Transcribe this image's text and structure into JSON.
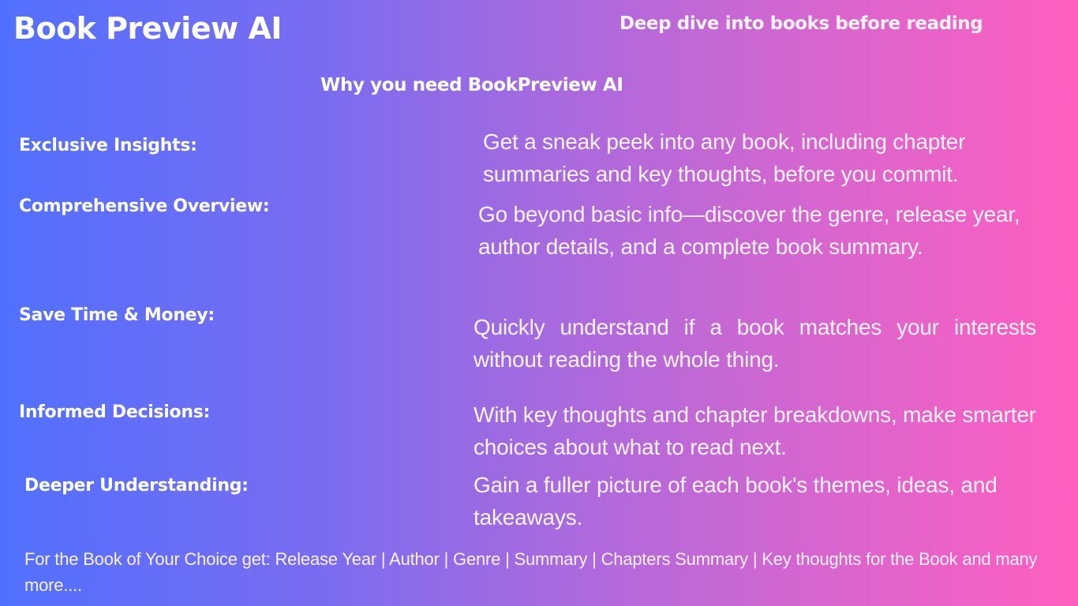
{
  "header": {
    "brand": "Book Preview AI",
    "tagline": "Deep dive into books before reading"
  },
  "section": {
    "heading": "Why you need BookPreview AI"
  },
  "features": [
    {
      "label": "Exclusive Insights:",
      "description": "Get a sneak peek into any book, including chapter summaries and key thoughts, before you commit."
    },
    {
      "label": "Comprehensive Overview:",
      "description": "Go beyond basic info—discover the genre, release year, author details, and a complete book summary."
    },
    {
      "label": "Save Time & Money:",
      "description": "Quickly understand if a book matches your interests without reading the whole thing."
    },
    {
      "label": "Informed Decisions:",
      "description": "With key thoughts and chapter breakdowns, make smarter choices about what to read next."
    },
    {
      "label": "Deeper Understanding:",
      "description": "Gain a fuller picture of each book's themes, ideas, and takeaways."
    }
  ],
  "footer": {
    "text": "For the Book of Your Choice get: Release Year | Author | Genre | Summary | Chapters Summary | Key thoughts for the Book and many more...."
  },
  "colors": {
    "gradient_start": "#5170ff",
    "gradient_mid": "#a56adf",
    "gradient_end": "#ff5fbf",
    "text": "#ffffff"
  }
}
